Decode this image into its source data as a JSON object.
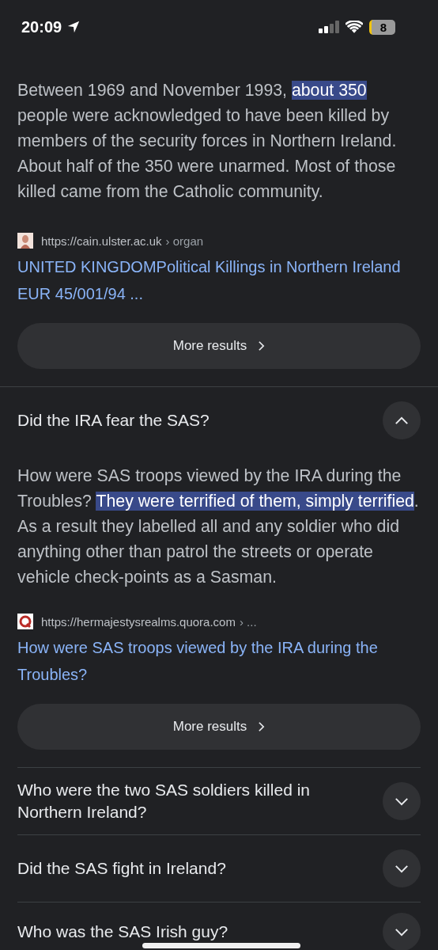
{
  "status_bar": {
    "time": "20:09",
    "battery": "8"
  },
  "top_answer": {
    "paragraph": [
      {
        "text": "Between 1969 and November 1993, ",
        "highlighted": false
      },
      {
        "text": "about 350",
        "highlighted": true
      },
      {
        "text": " people were acknowledged to have been killed by members of the security forces in Northern Ireland. About half of the 350 were unarmed. Most of those killed came from the Catholic community.",
        "highlighted": false
      }
    ],
    "source": {
      "url": "https://cain.ulster.ac.uk",
      "path": "› organ",
      "kind": "figure"
    },
    "title": "UNITED KINGDOMPolitical Killings in Northern Ireland EUR 45/001/94 ...",
    "button": "More results"
  },
  "questions": [
    {
      "question": "Did the IRA fear the SAS?",
      "expanded": true,
      "answer": {
        "paragraph": [
          {
            "text": "How were SAS troops viewed by the IRA during the Troubles? ",
            "highlighted": false
          },
          {
            "text": "They were terrified of them, simply terrified",
            "highlighted": true
          },
          {
            "text": ". As a result they labelled all and any soldier who did anything other than patrol the streets or operate vehicle check-points as a Sasman.",
            "highlighted": false
          }
        ],
        "source": {
          "url": "https://hermajestysrealms.quora.com",
          "path": "› ...",
          "kind": "ring"
        },
        "title": "How were SAS troops viewed by the IRA during the Troubles?",
        "button": "More results"
      }
    },
    {
      "question": "Who were the two SAS soldiers killed in Northern Ireland?",
      "expanded": false
    },
    {
      "question": "Did the SAS fight in Ireland?",
      "expanded": false
    },
    {
      "question": "Who was the SAS Irish guy?",
      "expanded": false
    }
  ]
}
